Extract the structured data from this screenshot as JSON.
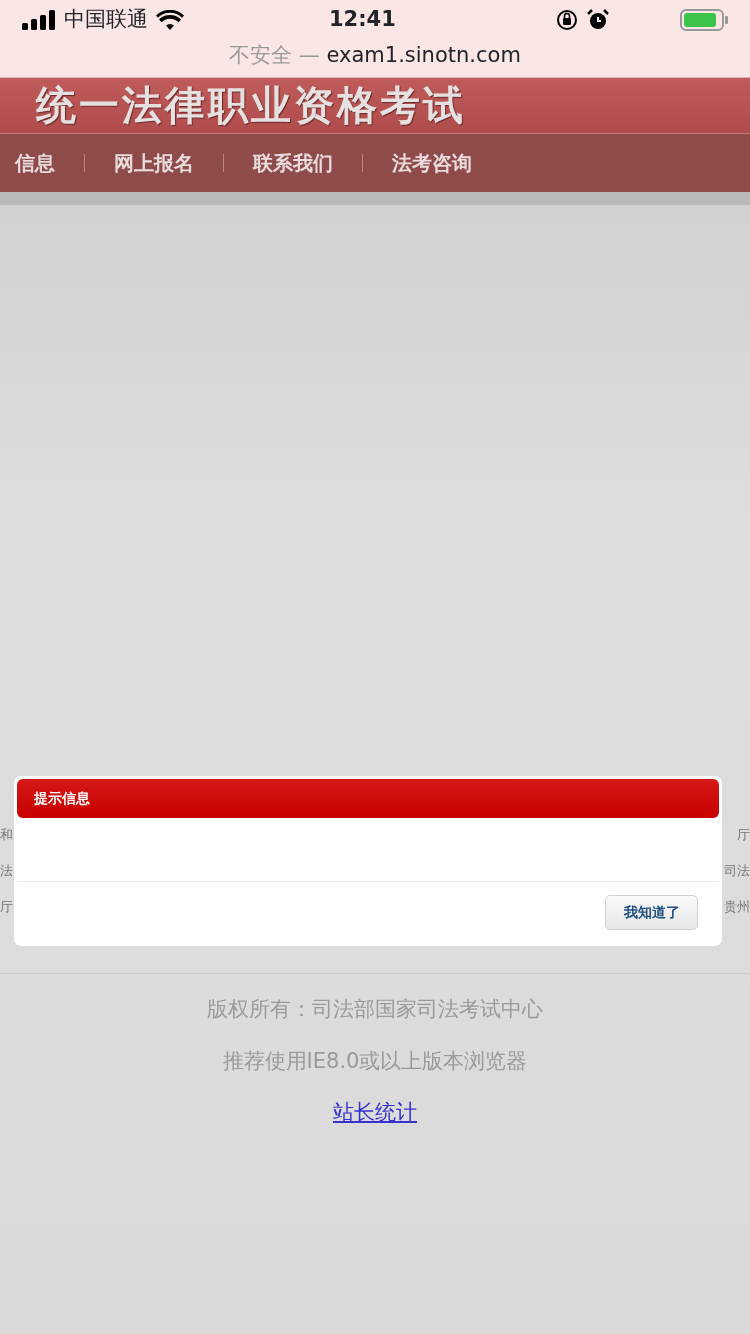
{
  "status_bar": {
    "carrier": "中国联通",
    "time": "12:41"
  },
  "address_bar": {
    "security": "不安全",
    "separator": "—",
    "url": "exam1.sinotn.com"
  },
  "banner": {
    "title": "统一法律职业资格考试"
  },
  "nav": {
    "items": [
      {
        "label": "信息"
      },
      {
        "label": "网上报名"
      },
      {
        "label": "联系我们"
      },
      {
        "label": "法考咨询"
      }
    ]
  },
  "footer_links": {
    "rows": [
      {
        "left": "和",
        "right": "厅"
      },
      {
        "left": "法",
        "right": "司法"
      },
      {
        "left": "厅",
        "right": "贵州"
      }
    ]
  },
  "footer": {
    "copyright": "版权所有：司法部国家司法考试中心",
    "browser_note": "推荐使用IE8.0或以上版本浏览器",
    "stats_link": "站长统计"
  },
  "dialog": {
    "title": "提示信息",
    "button": "我知道了"
  }
}
